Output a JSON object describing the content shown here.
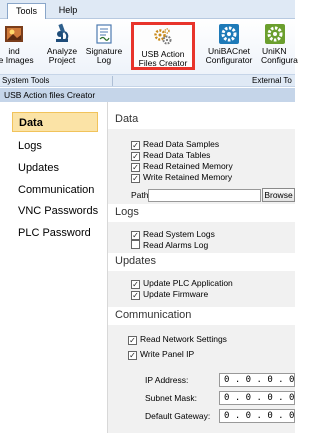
{
  "ribbon": {
    "tabs": [
      {
        "label": "Tools",
        "active": true
      },
      {
        "label": "Help",
        "active": false
      }
    ],
    "buttons": [
      {
        "line1": "ind",
        "line2": "ze Images",
        "icon": "image-icon"
      },
      {
        "line1": "Analyze",
        "line2": "Project",
        "icon": "microscope-icon"
      },
      {
        "line1": "Signature",
        "line2": "Log",
        "icon": "document-icon"
      },
      {
        "line1": "USB Action",
        "line2": "Files Creator",
        "icon": "gears-icon",
        "highlighted": true
      },
      {
        "line1": "UniBACnet",
        "line2": "Configurator",
        "icon": "uni-bacnet-icon"
      },
      {
        "line1": "UniKN",
        "line2": "Configura",
        "icon": "uni-knx-icon"
      }
    ],
    "groups": [
      "System Tools",
      "External To"
    ]
  },
  "window_title": "USB Action files  Creator",
  "nav": {
    "items": [
      {
        "label": "Data",
        "selected": true
      },
      {
        "label": "Logs",
        "selected": false
      },
      {
        "label": "Updates",
        "selected": false
      },
      {
        "label": "Communication",
        "selected": false
      },
      {
        "label": "VNC Passwords",
        "selected": false
      },
      {
        "label": "PLC Password",
        "selected": false
      }
    ]
  },
  "content": {
    "data": {
      "heading": "Data",
      "checkboxes": [
        {
          "label": "Read Data Samples",
          "checked": true
        },
        {
          "label": "Read Data Tables",
          "checked": true
        },
        {
          "label": "Read Retained Memory",
          "checked": true
        },
        {
          "label": "Write Retained Memory",
          "checked": true
        }
      ],
      "path_label": "Path:",
      "path_value": "",
      "browse_label": "Browse"
    },
    "logs": {
      "heading": "Logs",
      "checkboxes": [
        {
          "label": "Read System Logs",
          "checked": true
        },
        {
          "label": "Read Alarms Log",
          "checked": false
        }
      ]
    },
    "updates": {
      "heading": "Updates",
      "checkboxes": [
        {
          "label": "Update PLC Application",
          "checked": true
        },
        {
          "label": "Update Firmware",
          "checked": true
        }
      ]
    },
    "communication": {
      "heading": "Communication",
      "checkboxes": [
        {
          "label": "Read Network Settings",
          "checked": true
        },
        {
          "label": "Write Panel IP",
          "checked": true
        }
      ],
      "ip_label": "IP Address:",
      "ip_value": "0 . 0 . 0 . 0",
      "subnet_label": "Subnet Mask:",
      "subnet_value": "0 . 0 . 0 . 0",
      "gateway_label": "Default Gateway:",
      "gateway_value": "0 . 0 . 0 . 0"
    }
  },
  "colors": {
    "highlight_border": "#e8342b",
    "selected_nav_bg": "#fbe3a6",
    "title_bar_bg": "#c5d5e9"
  }
}
